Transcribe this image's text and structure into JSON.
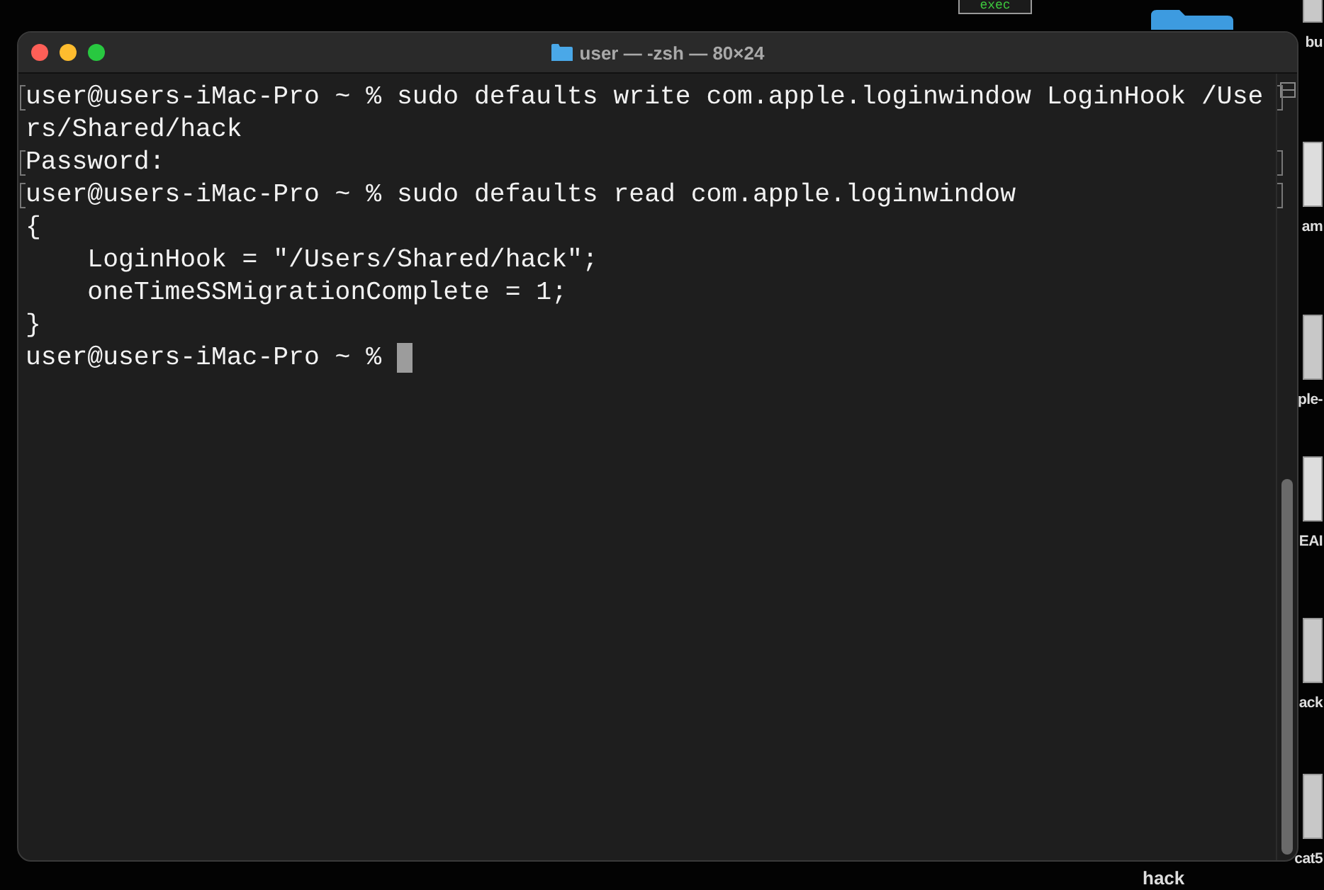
{
  "window": {
    "title": "user — -zsh — 80×24"
  },
  "terminal": {
    "lines": [
      {
        "text": "user@users-iMac-Pro ~ % sudo defaults write com.apple.loginwindow LoginHook /Use",
        "marked": true
      },
      {
        "text": "rs/Shared/hack",
        "marked": false
      },
      {
        "text": "Password:",
        "marked": true
      },
      {
        "text": "user@users-iMac-Pro ~ % sudo defaults read com.apple.loginwindow",
        "marked": true
      },
      {
        "text": "{",
        "marked": false
      },
      {
        "text": "    LoginHook = \"/Users/Shared/hack\";",
        "marked": false
      },
      {
        "text": "    oneTimeSSMigrationComplete = 1;",
        "marked": false
      },
      {
        "text": "}",
        "marked": false
      },
      {
        "text": "user@users-iMac-Pro ~ % ",
        "marked": false,
        "cursor": true
      }
    ]
  },
  "desktop_icons": [
    {
      "label": "exec",
      "kind": "script"
    },
    {
      "label": "bu",
      "kind": "image"
    },
    {
      "label": "am",
      "kind": "document"
    },
    {
      "label": "ple-",
      "kind": "image"
    },
    {
      "label": "EAI",
      "kind": "document"
    },
    {
      "label": "ack",
      "kind": "image"
    },
    {
      "label": "cat5",
      "kind": "image"
    },
    {
      "label": "hack",
      "kind": "folder"
    }
  ]
}
